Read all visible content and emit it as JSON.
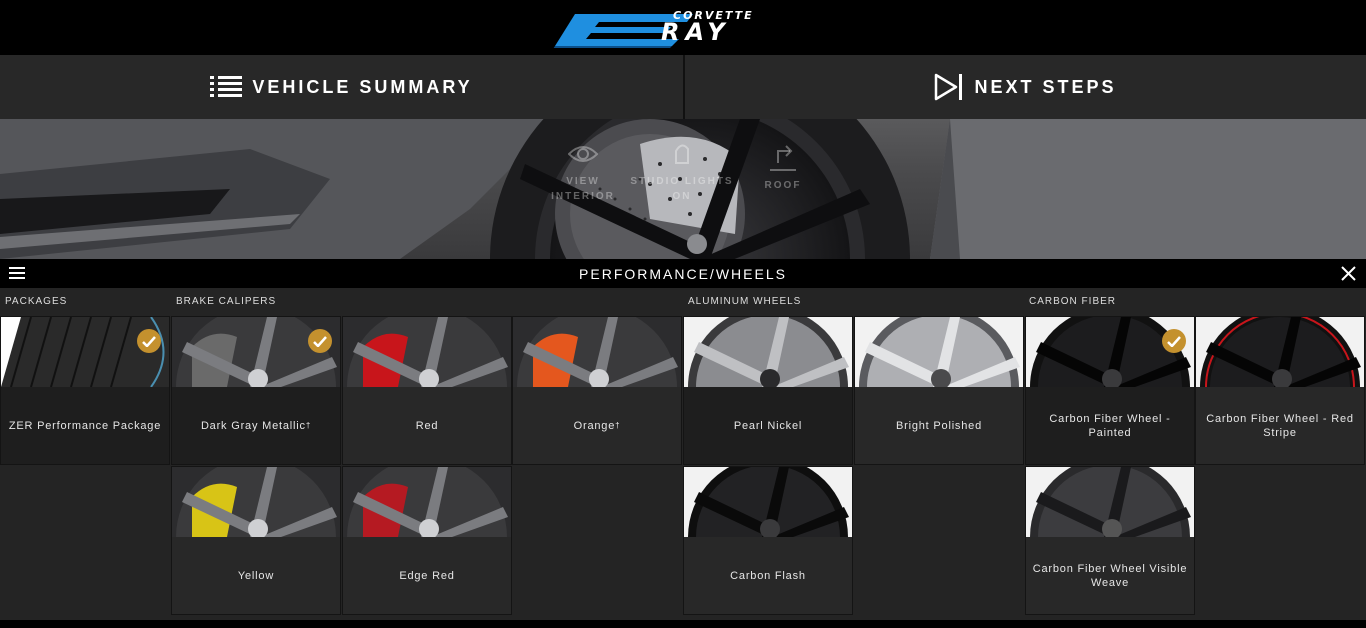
{
  "brand": {
    "word": "CORVETTE",
    "model": "RAY"
  },
  "nav": {
    "vehicle_summary": "VEHICLE SUMMARY",
    "next_steps": "NEXT STEPS"
  },
  "hero_controls": [
    {
      "line1": "VIEW",
      "line2": "INTERIOR",
      "icon": "eye-icon"
    },
    {
      "line1": "STUDIO LIGHTS",
      "line2": "ON",
      "icon": "lightbulb-icon"
    },
    {
      "line1": "ROOF",
      "line2": "",
      "icon": "roof-icon"
    }
  ],
  "panel": {
    "title": "PERFORMANCE/WHEELS"
  },
  "sections": {
    "packages": "PACKAGES",
    "brake_calipers": "BRAKE CALIPERS",
    "aluminum_wheels": "ALUMINUM WHEELS",
    "carbon_fiber": "CARBON FIBER"
  },
  "options": {
    "zer": {
      "label": "ZER Performance Package",
      "selected": true
    },
    "dark_gray": {
      "label": "Dark Gray Metallic",
      "mark": "†",
      "selected": true,
      "color": "#6a6a6a"
    },
    "red": {
      "label": "Red",
      "selected": false,
      "color": "#c8151b"
    },
    "orange": {
      "label": "Orange",
      "mark": "†",
      "selected": false,
      "color": "#e4571e"
    },
    "yellow": {
      "label": "Yellow",
      "selected": false,
      "color": "#d8c416"
    },
    "edge_red": {
      "label": "Edge Red",
      "selected": false,
      "color": "#b51a22"
    },
    "pearl_nickel": {
      "label": "Pearl Nickel",
      "selected": false
    },
    "bright_polished": {
      "label": "Bright Polished",
      "selected": false
    },
    "carbon_flash": {
      "label": "Carbon Flash",
      "selected": false
    },
    "cf_painted": {
      "label": "Carbon Fiber Wheel - Painted",
      "selected": true
    },
    "cf_red_stripe": {
      "label": "Carbon Fiber Wheel - Red Stripe",
      "selected": false
    },
    "cf_visible_weave": {
      "label": "Carbon Fiber Wheel Visible Weave",
      "selected": false
    }
  },
  "colors": {
    "accent_check": "#c4912e",
    "logo_blue": "#1f8fe0"
  }
}
